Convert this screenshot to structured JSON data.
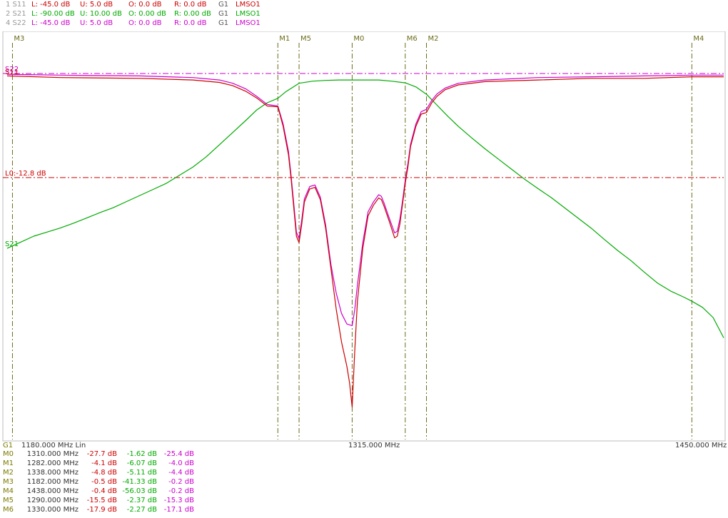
{
  "traces": [
    {
      "label": "1 S11",
      "L": "L: -45.0 dB",
      "U": "U: 5.0 dB",
      "O": "O: 0.0 dB",
      "R": "R: 0.0 dB",
      "G": "G1",
      "cal": "LMSO1",
      "color": "#cc0000"
    },
    {
      "label": "2 S21",
      "L": "L: -90.00 dB",
      "U": "U: 10.00 dB",
      "O": "O: 0.00 dB",
      "R": "R: 0.00 dB",
      "G": "G1",
      "cal": "LMSO1",
      "color": "#00aa00"
    },
    {
      "label": "4 S22",
      "L": "L: -45.0 dB",
      "U": "U: 5.0 dB",
      "O": "O: 0.0 dB",
      "R": "R: 0.0 dB",
      "G": "G1",
      "cal": "LMSO1",
      "color": "#cc00cc"
    }
  ],
  "axis": {
    "group": "G1",
    "start": "1180.000 MHz Lin",
    "center": "1315.000 MHz",
    "stop": "1450.000 MHz"
  },
  "limit_label": "L0:-12.8 dB",
  "trace_tags": {
    "s11": "S11",
    "s22": "S22",
    "s21": "S21"
  },
  "marker_tags": [
    "M3",
    "M1",
    "M5",
    "M0",
    "M6",
    "M2",
    "M4"
  ],
  "markers": [
    {
      "name": "M0",
      "freq": "1310.000 MHz",
      "s11": "-27.7 dB",
      "s21": "-1.62 dB",
      "s22": "-25.4 dB"
    },
    {
      "name": "M1",
      "freq": "1282.000 MHz",
      "s11": "-4.1 dB",
      "s21": "-6.07 dB",
      "s22": "-4.0 dB"
    },
    {
      "name": "M2",
      "freq": "1338.000 MHz",
      "s11": "-4.8 dB",
      "s21": "-5.11 dB",
      "s22": "-4.4 dB"
    },
    {
      "name": "M3",
      "freq": "1182.000 MHz",
      "s11": "-0.5 dB",
      "s21": "-41.33 dB",
      "s22": "-0.2 dB"
    },
    {
      "name": "M4",
      "freq": "1438.000 MHz",
      "s11": "-0.4 dB",
      "s21": "-56.03 dB",
      "s22": "-0.2 dB"
    },
    {
      "name": "M5",
      "freq": "1290.000 MHz",
      "s11": "-15.5 dB",
      "s21": "-2.37 dB",
      "s22": "-15.3 dB"
    },
    {
      "name": "M6",
      "freq": "1330.000 MHz",
      "s11": "-17.9 dB",
      "s21": "-2.27 dB",
      "s22": "-17.1 dB"
    }
  ],
  "chart_data": {
    "type": "line",
    "xlim": [
      1180,
      1450
    ],
    "x_unit": "MHz",
    "limit_line_db": -12.8,
    "series": [
      {
        "name": "S11",
        "ylim": [
          -45,
          5
        ],
        "color": "#cc0000",
        "points": [
          [
            1180,
            -0.3
          ],
          [
            1200,
            -0.5
          ],
          [
            1230,
            -0.6
          ],
          [
            1250,
            -0.8
          ],
          [
            1260,
            -1.1
          ],
          [
            1265,
            -1.5
          ],
          [
            1270,
            -2.2
          ],
          [
            1274,
            -3.0
          ],
          [
            1278,
            -4.0
          ],
          [
            1282,
            -4.1
          ],
          [
            1284,
            -6.5
          ],
          [
            1286,
            -10.0
          ],
          [
            1287,
            -13.0
          ],
          [
            1288,
            -16.5
          ],
          [
            1289,
            -20.0
          ],
          [
            1290,
            -20.8
          ],
          [
            1291,
            -18.5
          ],
          [
            1292,
            -15.8
          ],
          [
            1294,
            -14.2
          ],
          [
            1296,
            -14.0
          ],
          [
            1298,
            -15.5
          ],
          [
            1300,
            -19.0
          ],
          [
            1302,
            -24.0
          ],
          [
            1304,
            -29.0
          ],
          [
            1306,
            -33.0
          ],
          [
            1308,
            -36.0
          ],
          [
            1309,
            -38.0
          ],
          [
            1310,
            -41.0
          ],
          [
            1311,
            -34.0
          ],
          [
            1312,
            -28.0
          ],
          [
            1314,
            -21.5
          ],
          [
            1316,
            -17.5
          ],
          [
            1318,
            -16.2
          ],
          [
            1320,
            -15.3
          ],
          [
            1321,
            -15.5
          ],
          [
            1322,
            -16.3
          ],
          [
            1324,
            -18.2
          ],
          [
            1326,
            -20.2
          ],
          [
            1327,
            -20.0
          ],
          [
            1328,
            -18.5
          ],
          [
            1329,
            -16.0
          ],
          [
            1330,
            -13.5
          ],
          [
            1331,
            -11.5
          ],
          [
            1332,
            -9.0
          ],
          [
            1334,
            -6.5
          ],
          [
            1336,
            -5.0
          ],
          [
            1338,
            -4.8
          ],
          [
            1340,
            -3.6
          ],
          [
            1342,
            -2.8
          ],
          [
            1345,
            -2.0
          ],
          [
            1350,
            -1.4
          ],
          [
            1360,
            -1.0
          ],
          [
            1380,
            -0.8
          ],
          [
            1400,
            -0.6
          ],
          [
            1420,
            -0.6
          ],
          [
            1438,
            -0.4
          ],
          [
            1450,
            -0.4
          ]
        ]
      },
      {
        "name": "S22",
        "ylim": [
          -45,
          5
        ],
        "color": "#cc00cc",
        "points": [
          [
            1180,
            -0.1
          ],
          [
            1200,
            -0.2
          ],
          [
            1230,
            -0.3
          ],
          [
            1250,
            -0.5
          ],
          [
            1260,
            -0.8
          ],
          [
            1265,
            -1.2
          ],
          [
            1270,
            -1.9
          ],
          [
            1274,
            -2.8
          ],
          [
            1278,
            -3.8
          ],
          [
            1282,
            -4.0
          ],
          [
            1284,
            -6.2
          ],
          [
            1286,
            -9.6
          ],
          [
            1287,
            -12.6
          ],
          [
            1288,
            -16.0
          ],
          [
            1289,
            -19.5
          ],
          [
            1290,
            -20.3
          ],
          [
            1291,
            -18.0
          ],
          [
            1292,
            -15.4
          ],
          [
            1294,
            -13.9
          ],
          [
            1296,
            -13.7
          ],
          [
            1298,
            -15.2
          ],
          [
            1300,
            -18.6
          ],
          [
            1302,
            -23.5
          ],
          [
            1304,
            -27.0
          ],
          [
            1306,
            -29.5
          ],
          [
            1308,
            -30.8
          ],
          [
            1310,
            -31.0
          ],
          [
            1311,
            -29.0
          ],
          [
            1312,
            -26.0
          ],
          [
            1314,
            -20.8
          ],
          [
            1316,
            -17.0
          ],
          [
            1318,
            -15.8
          ],
          [
            1320,
            -14.9
          ],
          [
            1321,
            -15.1
          ],
          [
            1322,
            -15.9
          ],
          [
            1324,
            -17.8
          ],
          [
            1326,
            -19.6
          ],
          [
            1327,
            -19.4
          ],
          [
            1328,
            -17.9
          ],
          [
            1329,
            -15.6
          ],
          [
            1330,
            -13.1
          ],
          [
            1331,
            -11.1
          ],
          [
            1332,
            -8.7
          ],
          [
            1334,
            -6.2
          ],
          [
            1336,
            -4.7
          ],
          [
            1338,
            -4.4
          ],
          [
            1340,
            -3.3
          ],
          [
            1342,
            -2.5
          ],
          [
            1345,
            -1.8
          ],
          [
            1350,
            -1.2
          ],
          [
            1360,
            -0.8
          ],
          [
            1380,
            -0.5
          ],
          [
            1400,
            -0.4
          ],
          [
            1420,
            -0.3
          ],
          [
            1438,
            -0.2
          ],
          [
            1450,
            -0.2
          ]
        ]
      },
      {
        "name": "S21",
        "ylim": [
          -90,
          10
        ],
        "color": "#00aa00",
        "points": [
          [
            1180,
            -43.0
          ],
          [
            1185,
            -41.5
          ],
          [
            1190,
            -40.0
          ],
          [
            1195,
            -39.0
          ],
          [
            1200,
            -38.0
          ],
          [
            1205,
            -36.8
          ],
          [
            1210,
            -35.5
          ],
          [
            1215,
            -34.2
          ],
          [
            1220,
            -33.0
          ],
          [
            1225,
            -31.5
          ],
          [
            1230,
            -30.0
          ],
          [
            1235,
            -28.5
          ],
          [
            1240,
            -27.0
          ],
          [
            1245,
            -25.0
          ],
          [
            1250,
            -23.0
          ],
          [
            1255,
            -20.5
          ],
          [
            1260,
            -17.5
          ],
          [
            1265,
            -14.5
          ],
          [
            1270,
            -11.5
          ],
          [
            1274,
            -9.0
          ],
          [
            1278,
            -7.2
          ],
          [
            1282,
            -6.1
          ],
          [
            1285,
            -4.5
          ],
          [
            1290,
            -2.4
          ],
          [
            1295,
            -1.9
          ],
          [
            1300,
            -1.7
          ],
          [
            1305,
            -1.6
          ],
          [
            1310,
            -1.6
          ],
          [
            1315,
            -1.6
          ],
          [
            1320,
            -1.6
          ],
          [
            1325,
            -1.9
          ],
          [
            1330,
            -2.3
          ],
          [
            1334,
            -3.3
          ],
          [
            1338,
            -5.1
          ],
          [
            1342,
            -7.8
          ],
          [
            1346,
            -10.5
          ],
          [
            1350,
            -13.0
          ],
          [
            1355,
            -15.8
          ],
          [
            1360,
            -18.5
          ],
          [
            1365,
            -21.0
          ],
          [
            1370,
            -23.5
          ],
          [
            1375,
            -26.0
          ],
          [
            1380,
            -28.3
          ],
          [
            1385,
            -30.5
          ],
          [
            1390,
            -33.0
          ],
          [
            1395,
            -35.5
          ],
          [
            1400,
            -38.0
          ],
          [
            1405,
            -40.8
          ],
          [
            1410,
            -43.5
          ],
          [
            1415,
            -46.0
          ],
          [
            1420,
            -48.8
          ],
          [
            1425,
            -51.5
          ],
          [
            1430,
            -53.5
          ],
          [
            1435,
            -55.0
          ],
          [
            1438,
            -56.0
          ],
          [
            1442,
            -57.5
          ],
          [
            1446,
            -60.0
          ],
          [
            1450,
            -65.0
          ]
        ]
      }
    ]
  }
}
